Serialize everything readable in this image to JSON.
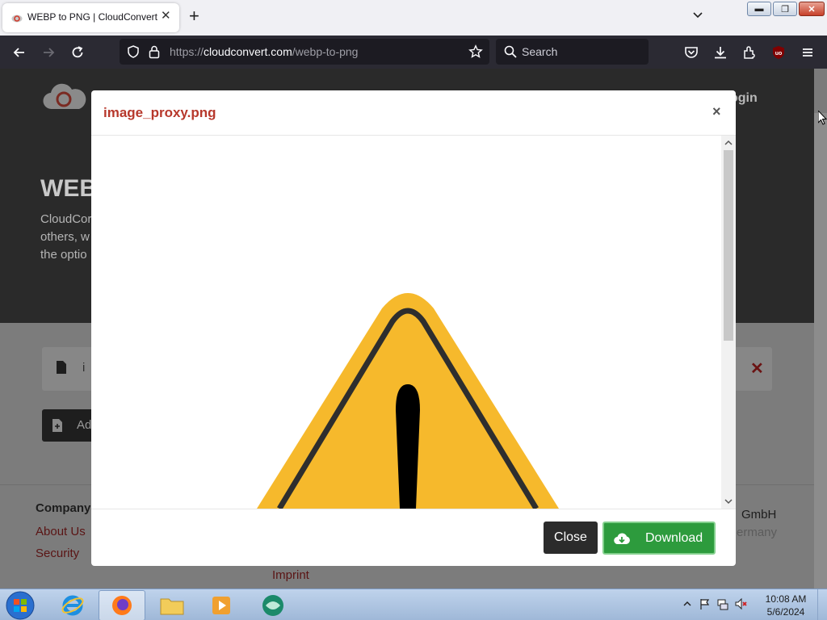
{
  "browser": {
    "tab_title": "WEBP to PNG | CloudConvert",
    "url_prefix": "https://",
    "url_domain": "cloudconvert.com",
    "url_path": "/webp-to-png",
    "search_placeholder": "Search",
    "accent": "#2b2a33"
  },
  "page": {
    "login_label": "ogin",
    "hero_title": "WEB",
    "hero_description": "CloudCor others, w the optio",
    "file_name": "i",
    "add_label": "Ad",
    "footer": {
      "company_heading": "Company",
      "links": [
        "About Us",
        "Security",
        "Imprint"
      ],
      "address_line1": "GmbH",
      "address_line2": "ermany"
    }
  },
  "modal": {
    "title": "image_proxy.png",
    "close_x": "×",
    "close_button": "Close",
    "download_button": "Download",
    "title_color": "#b7382c",
    "download_color": "#2d9b3d"
  },
  "taskbar": {
    "time": "10:08 AM",
    "date": "5/6/2024"
  }
}
